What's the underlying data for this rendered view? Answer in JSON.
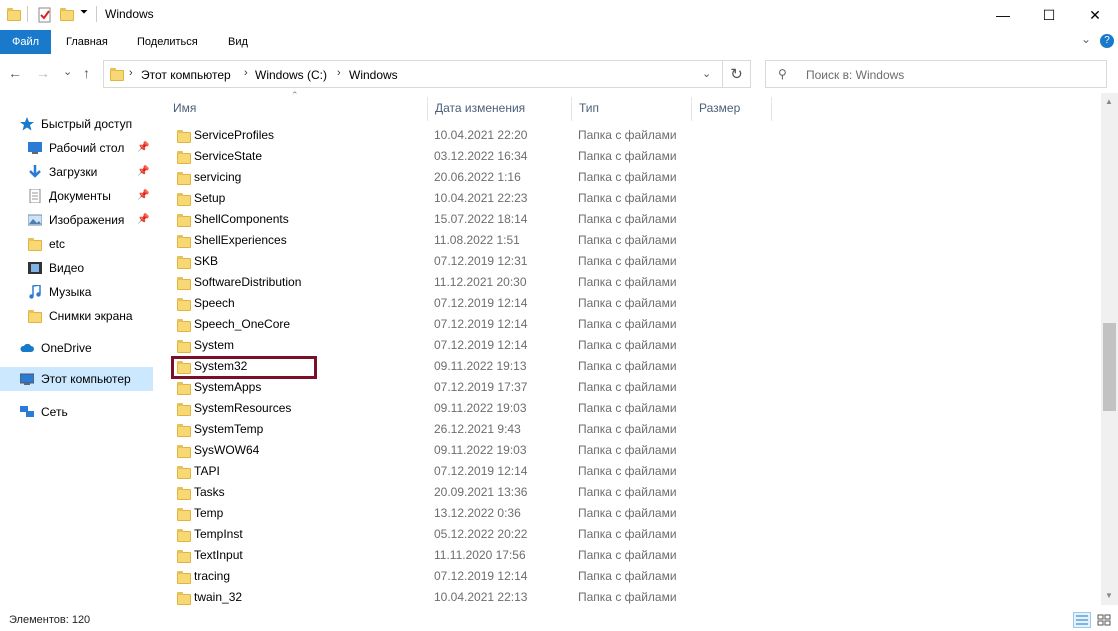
{
  "window": {
    "title": "Windows",
    "minimize": "—",
    "maximize": "☐",
    "close": "✕"
  },
  "ribbon": {
    "tabs": [
      "Файл",
      "Главная",
      "Поделиться",
      "Вид"
    ],
    "expand": "⌄",
    "help": "?"
  },
  "nav": {
    "back": "←",
    "forward": "→",
    "recent": "⌄",
    "up": "↑",
    "dropdown": "⌄",
    "refresh": "↻"
  },
  "breadcrumb": [
    "Этот компьютер",
    "Windows (C:)",
    "Windows"
  ],
  "search": {
    "placeholder": "Поиск в: Windows"
  },
  "sidebar": {
    "items": [
      {
        "label": "Быстрый доступ",
        "icon": "star-icon",
        "pinned": false
      },
      {
        "label": "Рабочий стол",
        "icon": "desktop-icon",
        "pinned": true
      },
      {
        "label": "Загрузки",
        "icon": "download-icon",
        "pinned": true
      },
      {
        "label": "Документы",
        "icon": "document-icon",
        "pinned": true
      },
      {
        "label": "Изображения",
        "icon": "pictures-icon",
        "pinned": true
      },
      {
        "label": "etc",
        "icon": "folder-icon",
        "pinned": false
      },
      {
        "label": "Видео",
        "icon": "video-icon",
        "pinned": false
      },
      {
        "label": "Музыка",
        "icon": "music-icon",
        "pinned": false
      },
      {
        "label": "Снимки экрана",
        "icon": "folder-icon",
        "pinned": false
      },
      {
        "label": "OneDrive",
        "icon": "cloud-icon",
        "pinned": false
      },
      {
        "label": "Этот компьютер",
        "icon": "computer-icon",
        "pinned": false,
        "selected": true
      },
      {
        "label": "Сеть",
        "icon": "network-icon",
        "pinned": false
      }
    ]
  },
  "columns": [
    "Имя",
    "Дата изменения",
    "Тип",
    "Размер"
  ],
  "files": [
    {
      "name": "ServiceProfiles",
      "date": "10.04.2021 22:20",
      "type": "Папка с файлами"
    },
    {
      "name": "ServiceState",
      "date": "03.12.2022 16:34",
      "type": "Папка с файлами"
    },
    {
      "name": "servicing",
      "date": "20.06.2022 1:16",
      "type": "Папка с файлами"
    },
    {
      "name": "Setup",
      "date": "10.04.2021 22:23",
      "type": "Папка с файлами"
    },
    {
      "name": "ShellComponents",
      "date": "15.07.2022 18:14",
      "type": "Папка с файлами"
    },
    {
      "name": "ShellExperiences",
      "date": "11.08.2022 1:51",
      "type": "Папка с файлами"
    },
    {
      "name": "SKB",
      "date": "07.12.2019 12:31",
      "type": "Папка с файлами"
    },
    {
      "name": "SoftwareDistribution",
      "date": "11.12.2021 20:30",
      "type": "Папка с файлами"
    },
    {
      "name": "Speech",
      "date": "07.12.2019 12:14",
      "type": "Папка с файлами"
    },
    {
      "name": "Speech_OneCore",
      "date": "07.12.2019 12:14",
      "type": "Папка с файлами"
    },
    {
      "name": "System",
      "date": "07.12.2019 12:14",
      "type": "Папка с файлами"
    },
    {
      "name": "System32",
      "date": "09.11.2022 19:13",
      "type": "Папка с файлами"
    },
    {
      "name": "SystemApps",
      "date": "07.12.2019 17:37",
      "type": "Папка с файлами"
    },
    {
      "name": "SystemResources",
      "date": "09.11.2022 19:03",
      "type": "Папка с файлами"
    },
    {
      "name": "SystemTemp",
      "date": "26.12.2021 9:43",
      "type": "Папка с файлами"
    },
    {
      "name": "SysWOW64",
      "date": "09.11.2022 19:03",
      "type": "Папка с файлами"
    },
    {
      "name": "TAPI",
      "date": "07.12.2019 12:14",
      "type": "Папка с файлами"
    },
    {
      "name": "Tasks",
      "date": "20.09.2021 13:36",
      "type": "Папка с файлами"
    },
    {
      "name": "Temp",
      "date": "13.12.2022 0:36",
      "type": "Папка с файлами"
    },
    {
      "name": "TempInst",
      "date": "05.12.2022 20:22",
      "type": "Папка с файлами"
    },
    {
      "name": "TextInput",
      "date": "11.11.2020 17:56",
      "type": "Папка с файлами"
    },
    {
      "name": "tracing",
      "date": "07.12.2019 12:14",
      "type": "Папка с файлами"
    },
    {
      "name": "twain_32",
      "date": "10.04.2021 22:13",
      "type": "Папка с файлами"
    }
  ],
  "status": {
    "text": "Элементов: 120"
  },
  "colors": {
    "accent": "#1979ca",
    "highlight_border": "#7a0f2a",
    "folder": "#f8d775",
    "selected_bg": "#cce8ff"
  }
}
